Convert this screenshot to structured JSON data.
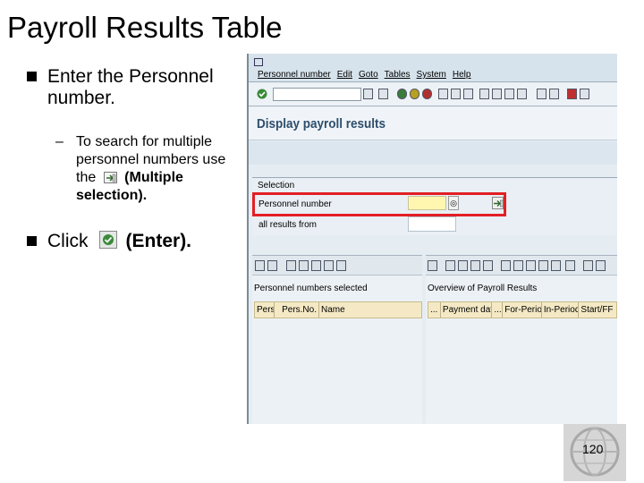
{
  "slide": {
    "title": "Payroll Results Table",
    "bullet1": "Enter the Personnel number.",
    "sub_bullet": {
      "dash": "–",
      "text_before": "To search for multiple personnel numbers use the",
      "text_bold": "(Multiple selection)",
      "text_after": "."
    },
    "bullet2": {
      "before": "Click",
      "after_bold": "(Enter",
      "after": ")."
    },
    "page_number": "120"
  },
  "sap": {
    "menu": [
      "Personnel number",
      "Edit",
      "Goto",
      "Tables",
      "System",
      "Help"
    ],
    "screen_title": "Display payroll results",
    "selection": {
      "title": "Selection",
      "personnel_number_label": "Personnel number",
      "personnel_number_value": "",
      "results_from_label": "all results from",
      "results_from_value": ""
    },
    "left_panel": {
      "caption": "Personnel numbers selected",
      "columns": [
        "Pers.",
        "Pers.No.",
        "Name"
      ]
    },
    "right_panel": {
      "caption": "Overview of Payroll Results",
      "columns": [
        "...",
        "Payment date",
        "...",
        "For-Period",
        "In-Period",
        "Start/FF"
      ]
    }
  }
}
